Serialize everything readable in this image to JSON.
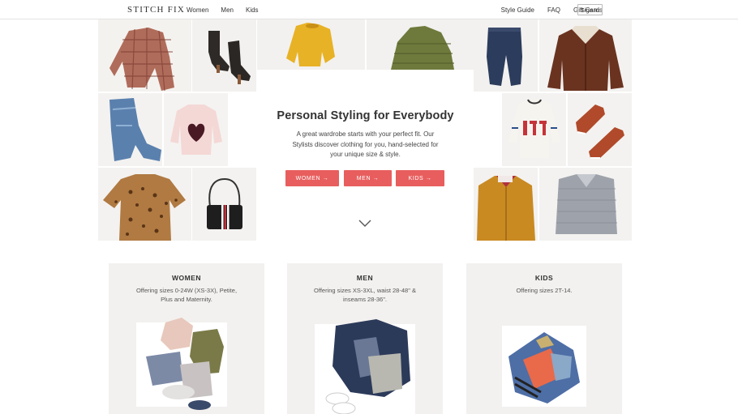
{
  "header": {
    "logo": "STITCH FIX",
    "nav_left": [
      "Women",
      "Men",
      "Kids"
    ],
    "nav_right": [
      "Style Guide",
      "FAQ",
      "Gift Cards"
    ],
    "signin": "Sign In"
  },
  "hero": {
    "title": "Personal Styling for Everybody",
    "description": "A great wardrobe starts with your perfect fit. Our Stylists discover clothing for you, hand-selected for your unique size & style.",
    "buttons": [
      "WOMEN →",
      "MEN →",
      "KIDS →"
    ],
    "accent_color": "#e85e5e"
  },
  "categories": [
    {
      "title": "WOMEN",
      "description": "Offering sizes 0-24W (XS-3X), Petite, Plus and Maternity."
    },
    {
      "title": "MEN",
      "description": "Offering sizes XS-3XL, waist 28-48\" & inseams 28-36\"."
    },
    {
      "title": "KIDS",
      "description": "Offering sizes 2T-14."
    }
  ],
  "icons": [
    "chevron-down-icon",
    "arrow-right-icon"
  ]
}
